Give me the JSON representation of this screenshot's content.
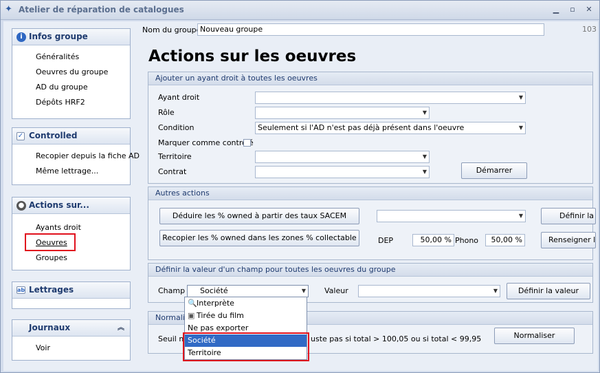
{
  "window": {
    "title": "Atelier de réparation de catalogues",
    "minimize": "▁",
    "maximize": "▫",
    "close": "✕"
  },
  "nav": {
    "infos_groupe": {
      "title": "Infos groupe",
      "items": [
        "Généralités",
        "Oeuvres du groupe",
        "AD du groupe",
        "Dépôts HRF2"
      ]
    },
    "controlled": {
      "title": "Controlled",
      "items": [
        "Recopier depuis la fiche AD",
        "Même lettrage..."
      ]
    },
    "actions_sur": {
      "title": "Actions sur...",
      "items": [
        "Ayants droit",
        "Oeuvres",
        "Groupes"
      ]
    },
    "lettrages": {
      "title": "Lettrages"
    },
    "journaux": {
      "title": "Journaux",
      "items": [
        "Voir"
      ]
    }
  },
  "header": {
    "nom_du_groupe_label": "Nom du groupe",
    "nom_du_groupe_value": "Nouveau groupe",
    "id": "103"
  },
  "page_title": "Actions sur les oeuvres",
  "section_ayant": {
    "title": "Ajouter un ayant droit à toutes les oeuvres",
    "ayant_droit_label": "Ayant droit",
    "ayant_droit_value": "",
    "role_label": "Rôle",
    "role_value": "",
    "condition_label": "Condition",
    "condition_value": "Seulement si l'AD n'est pas déjà présent dans l'oeuvre",
    "marquer_label": "Marquer comme contrôlé",
    "territoire_label": "Territoire",
    "territoire_value": "",
    "contrat_label": "Contrat",
    "contrat_value": "",
    "demarrer_button": "Démarrer"
  },
  "section_autres": {
    "title": "Autres actions",
    "deduire_button": "Déduire les % owned à partir des taux SACEM",
    "recopier_button": "Recopier les % owned dans les zones % collectable",
    "combo_value": "",
    "definir_button": "Définir la r",
    "dep_label": "DEP",
    "dep_value": "50,00 %",
    "phono_label": "Phono",
    "phono_value": "50,00 %",
    "renseigner_button": "Renseigner le"
  },
  "section_champ": {
    "title": "Définir la valeur d'un champ pour toutes les oeuvres du groupe",
    "champ_label": "Champ",
    "champ_value": "Société",
    "valeur_label": "Valeur",
    "valeur_value": "",
    "definir_valeur_button": "Définir la valeur"
  },
  "champ_dropdown": {
    "options": [
      "Interprète",
      "Tirée du film",
      "Ne pas exporter",
      "Société",
      "Territoire"
    ],
    "selected": "Société"
  },
  "section_normaliser": {
    "title_visible": "Normalise",
    "seuil_left": "Seuil ma",
    "seuil_right": "uste pas si total > 100,05 ou si total < 99,95",
    "normaliser_button": "Normaliser"
  }
}
